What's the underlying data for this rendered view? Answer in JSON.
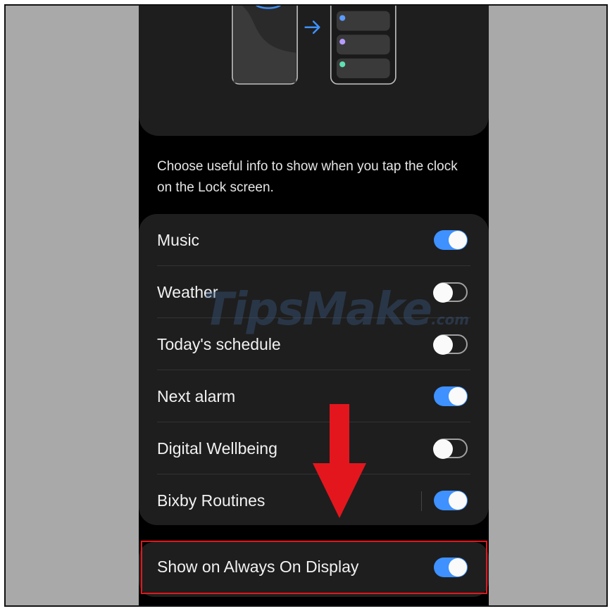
{
  "description": "Choose useful info to show when you tap the clock on the Lock screen.",
  "items": [
    {
      "label": "Music",
      "on": true
    },
    {
      "label": "Weather",
      "on": false
    },
    {
      "label": "Today's schedule",
      "on": false
    },
    {
      "label": "Next alarm",
      "on": true
    },
    {
      "label": "Digital Wellbeing",
      "on": false
    },
    {
      "label": "Bixby Routines",
      "on": true
    }
  ],
  "aod": {
    "label": "Show on Always On Display",
    "on": true
  },
  "watermark": {
    "main": "TipsMake",
    "suffix": ".com"
  },
  "colors": {
    "accent": "#3e91ff",
    "highlight": "#e3161d",
    "card": "#1e1e1e"
  }
}
